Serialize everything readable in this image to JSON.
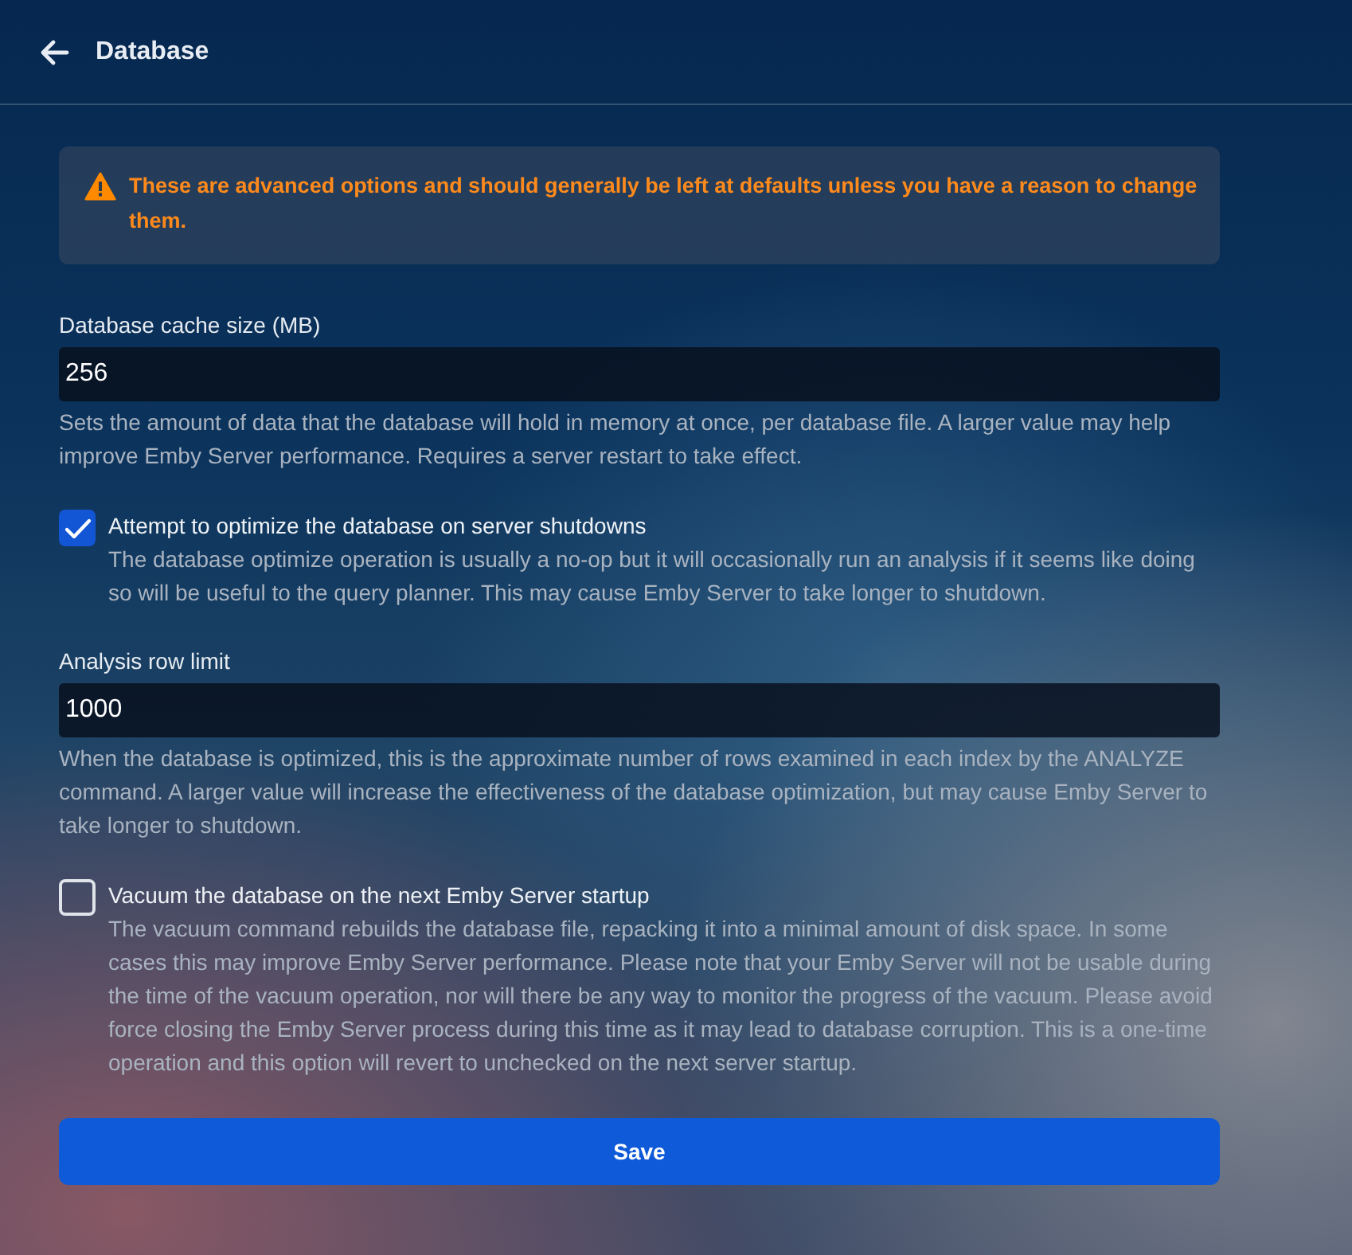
{
  "header": {
    "title": "Database"
  },
  "warning": "These are advanced options and should generally be left at defaults unless you have a reason to change them.",
  "settings": [
    {
      "kind": "input",
      "label": "Database cache size (MB)",
      "value": "256",
      "help": "Sets the amount of data that the database will hold in memory at once, per database file. A larger value may help improve Emby Server performance. Requires a server restart to take effect."
    },
    {
      "kind": "checkbox",
      "label": "Attempt to optimize the database on server shutdowns",
      "checked": true,
      "help": "The database optimize operation is usually a no-op but it will occasionally run an analysis if it seems like doing so will be useful to the query planner. This may cause Emby Server to take longer to shutdown."
    },
    {
      "kind": "input",
      "label": "Analysis row limit",
      "value": "1000",
      "help": "When the database is optimized, this is the approximate number of rows examined in each index by the ANALYZE command. A larger value will increase the effectiveness of the database optimization, but may cause Emby Server to take longer to shutdown."
    },
    {
      "kind": "checkbox",
      "label": "Vacuum the database on the next Emby Server startup",
      "checked": false,
      "help": "The vacuum command rebuilds the database file, repacking it into a minimal amount of disk space. In some cases this may improve Emby Server performance. Please note that your Emby Server will not be usable during the time of the vacuum operation, nor will there be any way to monitor the progress of the vacuum. Please avoid force closing the Emby Server process during this time as it may lead to database corruption. This is a one-time operation and this option will revert to unchecked on the next server startup."
    }
  ],
  "save_button": "Save"
}
